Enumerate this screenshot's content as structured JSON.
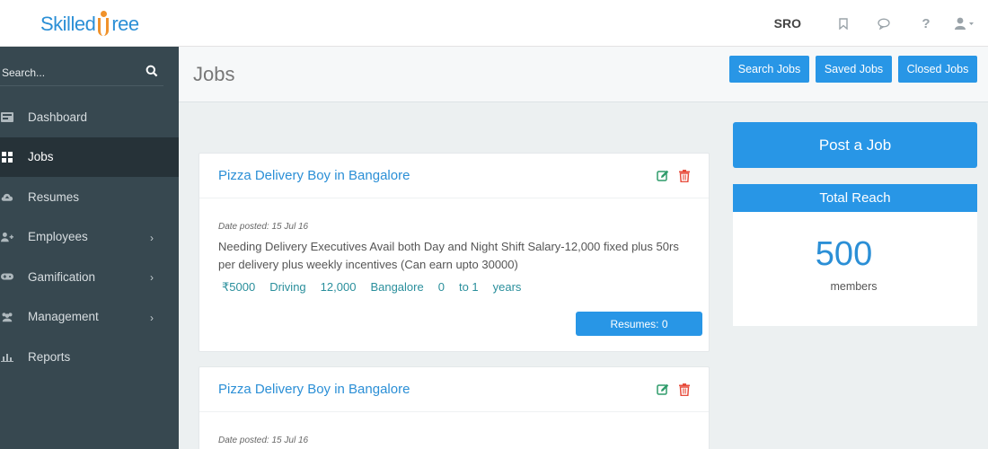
{
  "brand": {
    "logo_left": "Skilled",
    "logo_right": "ree"
  },
  "topbar": {
    "user_code": "SRO",
    "icons": [
      "bookmark-icon",
      "chat-icon",
      "help-icon",
      "user-icon"
    ],
    "help_glyph": "?"
  },
  "sidebar": {
    "search_placeholder": "Search...",
    "items": [
      {
        "label": "Dashboard",
        "icon": "dashboard-icon",
        "has_submenu": false,
        "active": false
      },
      {
        "label": "Jobs",
        "icon": "grid-icon",
        "has_submenu": false,
        "active": true
      },
      {
        "label": "Resumes",
        "icon": "cloud-upload-icon",
        "has_submenu": false,
        "active": false
      },
      {
        "label": "Employees",
        "icon": "user-plus-icon",
        "has_submenu": true,
        "active": false
      },
      {
        "label": "Gamification",
        "icon": "gamepad-icon",
        "has_submenu": true,
        "active": false
      },
      {
        "label": "Management",
        "icon": "users-icon",
        "has_submenu": true,
        "active": false
      },
      {
        "label": "Reports",
        "icon": "bar-chart-icon",
        "has_submenu": false,
        "active": false
      }
    ],
    "chevron": "›"
  },
  "header": {
    "title": "Jobs",
    "buttons": [
      "Search Jobs",
      "Saved Jobs",
      "Closed Jobs"
    ]
  },
  "jobs": [
    {
      "title": "Pizza Delivery Boy in Bangalore",
      "date_posted": "Date posted: 15 Jul 16",
      "description": "Needing Delivery Executives Avail both Day and Night Shift Salary-12,000 fixed plus 50rs per delivery plus weekly incentives (Can earn upto 30000)",
      "meta": [
        "₹5000",
        "Driving",
        "12,000",
        "Bangalore",
        "0",
        "to 1",
        "years"
      ],
      "resumes_button": "Resumes: 0"
    },
    {
      "title": "Pizza Delivery Boy in Bangalore",
      "date_posted": "Date posted: 15 Jul 16"
    }
  ],
  "post_job_button": "Post a Job",
  "reach": {
    "title": "Total Reach",
    "count": "500",
    "label": "members"
  },
  "colors": {
    "accent": "#2896e6",
    "sidebar": "#374850",
    "sidebar_active": "#263238",
    "meta_teal": "#2a8f9c",
    "delete_red": "#e74c3c",
    "edit_green": "#2e9b6a",
    "logo_orange": "#f0922b"
  }
}
